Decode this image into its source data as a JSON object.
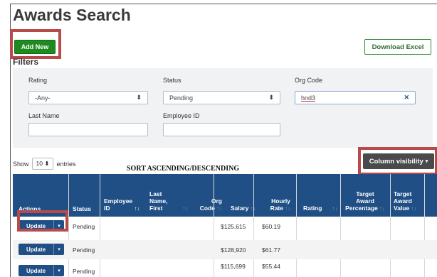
{
  "page": {
    "title": "Awards Search"
  },
  "toolbar": {
    "add_new": "Add New",
    "download_excel": "Download Excel"
  },
  "filters": {
    "heading": "Filters",
    "rating": {
      "label": "Rating",
      "value": "-Any-"
    },
    "status": {
      "label": "Status",
      "value": "Pending"
    },
    "org_code": {
      "label": "Org Code",
      "value": "hnd3"
    },
    "last_name": {
      "label": "Last Name",
      "value": ""
    },
    "employee_id": {
      "label": "Employee ID",
      "value": ""
    }
  },
  "entries": {
    "show": "Show",
    "value": "10",
    "entries": "entries"
  },
  "annotation": {
    "sort": "SORT ASCENDING/DESCENDING"
  },
  "column_visibility": "Column visibility",
  "table": {
    "headers": {
      "actions": "Actions",
      "status": "Status",
      "employee_id_1": "Employee",
      "employee_id_2": "ID",
      "last_first_1": "Last",
      "last_first_2": "Name,",
      "last_first_3": "First",
      "org_code_1": "Org",
      "org_code_2": "Code",
      "salary": "Salary",
      "hourly_rate_1": "Hourly",
      "hourly_rate_2": "Rate",
      "rating": "Rating",
      "target_pct_1": "Target",
      "target_pct_2": "Award",
      "target_pct_3": "Percentage",
      "target_val_1": "Target",
      "target_val_2": "Award",
      "target_val_3": "Value"
    },
    "rows": [
      {
        "action": "Update",
        "status": "Pending",
        "salary": "$125,615",
        "hourly": "$60.19"
      },
      {
        "action": "Update",
        "status": "Pending",
        "salary": "$128,920",
        "hourly": "$61.77"
      },
      {
        "action": "Update",
        "status": "Pending",
        "salary": "$115,699",
        "hourly": "$55.44"
      }
    ]
  },
  "colors": {
    "header_blue": "#1f4f85",
    "add_green": "#1f8a1f",
    "highlight_red": "#b94a4a"
  },
  "icons": {
    "sort": "sort-icon",
    "caret": "caret-down-icon",
    "clear": "close-icon"
  }
}
